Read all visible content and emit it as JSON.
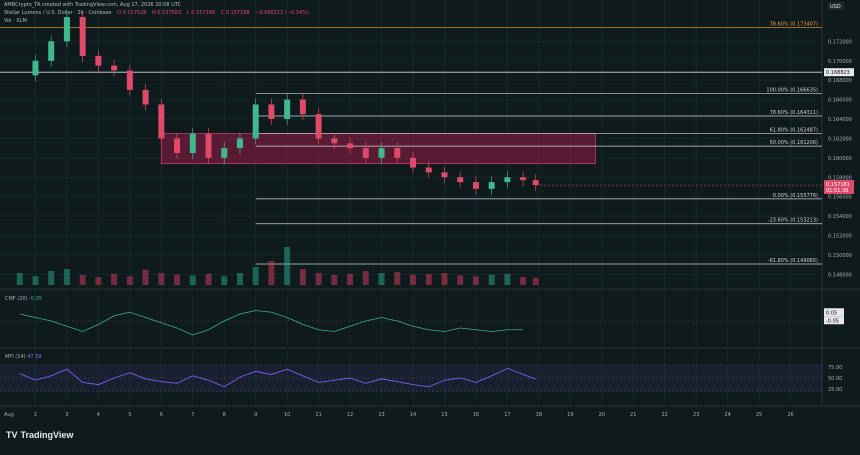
{
  "header": {
    "created_by": "AMBCrypto_TA created with TradingView.com, Aug 17, 2026 20:08 UTC",
    "symbol_line": "Stellar Lumens / U.S. Dollar · 2h · Coinbase",
    "ohlc": [
      "O 0.157528",
      "H 0.157583",
      "L 0.157188",
      "C 0.157188",
      "−0.000212 (−0.34%)"
    ],
    "volume_line": "Vol · XLM",
    "currency": "USD"
  },
  "price_axis": {
    "ticks": [
      "0.172000",
      "0.170000",
      "0.168000",
      "0.166000",
      "0.164000",
      "0.162000",
      "0.160000",
      "0.158000",
      "0.156000",
      "0.154000",
      "0.152000",
      "0.150000",
      "0.148000"
    ],
    "tick_values": [
      0.172,
      0.17,
      0.168,
      0.166,
      0.164,
      0.162,
      0.16,
      0.158,
      0.156,
      0.154,
      0.152,
      0.15,
      0.148
    ],
    "range": [
      0.1469,
      0.1742
    ],
    "horizontal_level_tag": "0.168823",
    "current_price_tag": "0.157181",
    "countdown_tag": "01:51:36"
  },
  "fib_levels": [
    {
      "label": "78.60% (0.173407)",
      "value": 0.173407,
      "color": "#f0a040"
    },
    {
      "label": "100.00% (0.166635)",
      "value": 0.166635,
      "color": "#d0d4da"
    },
    {
      "label": "78.60% (0.164311)",
      "value": 0.164311,
      "color": "#d0d4da"
    },
    {
      "label": "61.80% (0.162487)",
      "value": 0.162487,
      "color": "#d0d4da"
    },
    {
      "label": "50.00% (0.161206)",
      "value": 0.161206,
      "color": "#d0d4da"
    },
    {
      "label": "0.00% (0.155776)",
      "value": 0.155776,
      "color": "#d0d4da"
    },
    {
      "label": "-23.60% (0.153213)",
      "value": 0.153213,
      "color": "#d0d4da"
    },
    {
      "label": "-61.80% (0.149065)",
      "value": 0.149065,
      "color": "#d0d4da"
    }
  ],
  "horizontal_line_value": 0.168823,
  "supply_zone": {
    "from_day": 6,
    "to_day": 19.8,
    "low": 0.1594,
    "high": 0.1625
  },
  "chart_data": {
    "type": "candlestick",
    "title": "Stellar Lumens / U.S. Dollar · 2h · Coinbase",
    "x": [
      1.5,
      2,
      2.5,
      3,
      3.5,
      4,
      4.5,
      5,
      5.5,
      6,
      6.5,
      7,
      7.5,
      8,
      8.5,
      9,
      9.5,
      10,
      10.5,
      11,
      11.5,
      12,
      12.5,
      13,
      13.5,
      14,
      14.5,
      15,
      15.5,
      16,
      16.5,
      17,
      17.5,
      17.9
    ],
    "price": [
      0.1685,
      0.17,
      0.172,
      0.1745,
      0.1705,
      0.1695,
      0.169,
      0.167,
      0.1655,
      0.162,
      0.1605,
      0.1625,
      0.16,
      0.161,
      0.162,
      0.1655,
      0.164,
      0.166,
      0.1645,
      0.162,
      0.1615,
      0.161,
      0.16,
      0.161,
      0.16,
      0.159,
      0.1585,
      0.158,
      0.1575,
      0.1568,
      0.1575,
      0.158,
      0.1577,
      0.1572
    ],
    "volume": [
      30,
      22,
      35,
      40,
      25,
      20,
      28,
      22,
      38,
      30,
      26,
      24,
      28,
      22,
      30,
      45,
      60,
      95,
      40,
      30,
      25,
      28,
      35,
      30,
      32,
      26,
      28,
      30,
      24,
      22,
      26,
      28,
      20,
      18
    ],
    "xaxis_ticks": [
      "2",
      "3",
      "4",
      "5",
      "6",
      "7",
      "8",
      "9",
      "10",
      "11",
      "12",
      "13",
      "14",
      "15",
      "16",
      "17",
      "18",
      "19",
      "20",
      "21",
      "22",
      "23",
      "24",
      "25",
      "26"
    ],
    "xaxis_first_label": "Aug",
    "ylim": [
      0.1469,
      0.1742
    ]
  },
  "cmf": {
    "label": "CMF (20)",
    "value_label": "-0.05",
    "tags": [
      "0.05",
      "-0.05"
    ],
    "values": [
      0.04,
      0.02,
      0.0,
      -0.03,
      -0.06,
      -0.02,
      0.03,
      0.05,
      0.02,
      -0.01,
      -0.04,
      -0.08,
      -0.05,
      0.0,
      0.04,
      0.06,
      0.05,
      0.02,
      -0.02,
      -0.05,
      -0.06,
      -0.03,
      0.0,
      0.02,
      0.0,
      -0.03,
      -0.05,
      -0.06,
      -0.04,
      -0.05,
      -0.06,
      -0.05,
      -0.05
    ]
  },
  "mfi": {
    "label": "MFI (14)",
    "value_label": "47.59",
    "ticks": [
      "75.00",
      "50.00",
      "25.00"
    ],
    "values": [
      60,
      45,
      55,
      70,
      40,
      35,
      50,
      62,
      48,
      42,
      38,
      55,
      45,
      30,
      52,
      65,
      58,
      70,
      55,
      40,
      45,
      50,
      38,
      48,
      42,
      35,
      30,
      45,
      50,
      40,
      55,
      72,
      58,
      47.59
    ]
  },
  "branding": {
    "logo_text": "TradingView",
    "logo_mark": "TV"
  }
}
